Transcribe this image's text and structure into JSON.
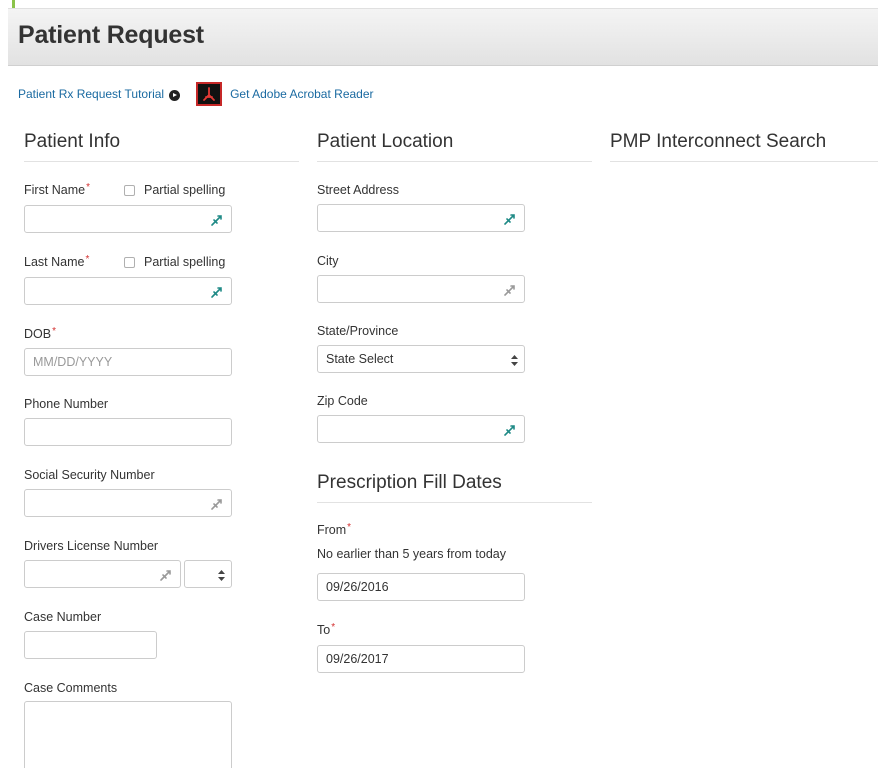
{
  "page": {
    "title": "Patient Request"
  },
  "links": {
    "tutorial": "Patient Rx Request Tutorial",
    "acrobat": "Get Adobe Acrobat Reader"
  },
  "sections": {
    "patient_info": "Patient Info",
    "patient_location": "Patient Location",
    "pmp_search": "PMP Interconnect Search",
    "fill_dates": "Prescription Fill Dates"
  },
  "patient_info": {
    "first_name_label": "First Name",
    "last_name_label": "Last Name",
    "partial_spelling": "Partial spelling",
    "dob_label": "DOB",
    "dob_placeholder": "MM/DD/YYYY",
    "phone_label": "Phone Number",
    "ssn_label": "Social Security Number",
    "dl_label": "Drivers License Number",
    "case_number_label": "Case Number",
    "case_comments_label": "Case Comments",
    "required_mark": "*"
  },
  "patient_location": {
    "street_label": "Street Address",
    "city_label": "City",
    "state_label": "State/Province",
    "state_value": "State Select",
    "zip_label": "Zip Code"
  },
  "fill_dates": {
    "from_label": "From",
    "from_help": "No earlier than 5 years from today",
    "from_value": "09/26/2016",
    "to_label": "To",
    "to_value": "09/26/2017"
  },
  "colors": {
    "link": "#1a6aa1",
    "required": "#d32f2f",
    "pen_icon_teal": "#1f8a86",
    "acrobat_red": "#c62828"
  },
  "icons": {
    "tutorial": "circle-arrow-icon",
    "acrobat": "acrobat-icon",
    "field_helper": "pen-icon",
    "select": "updown-arrows-icon"
  }
}
